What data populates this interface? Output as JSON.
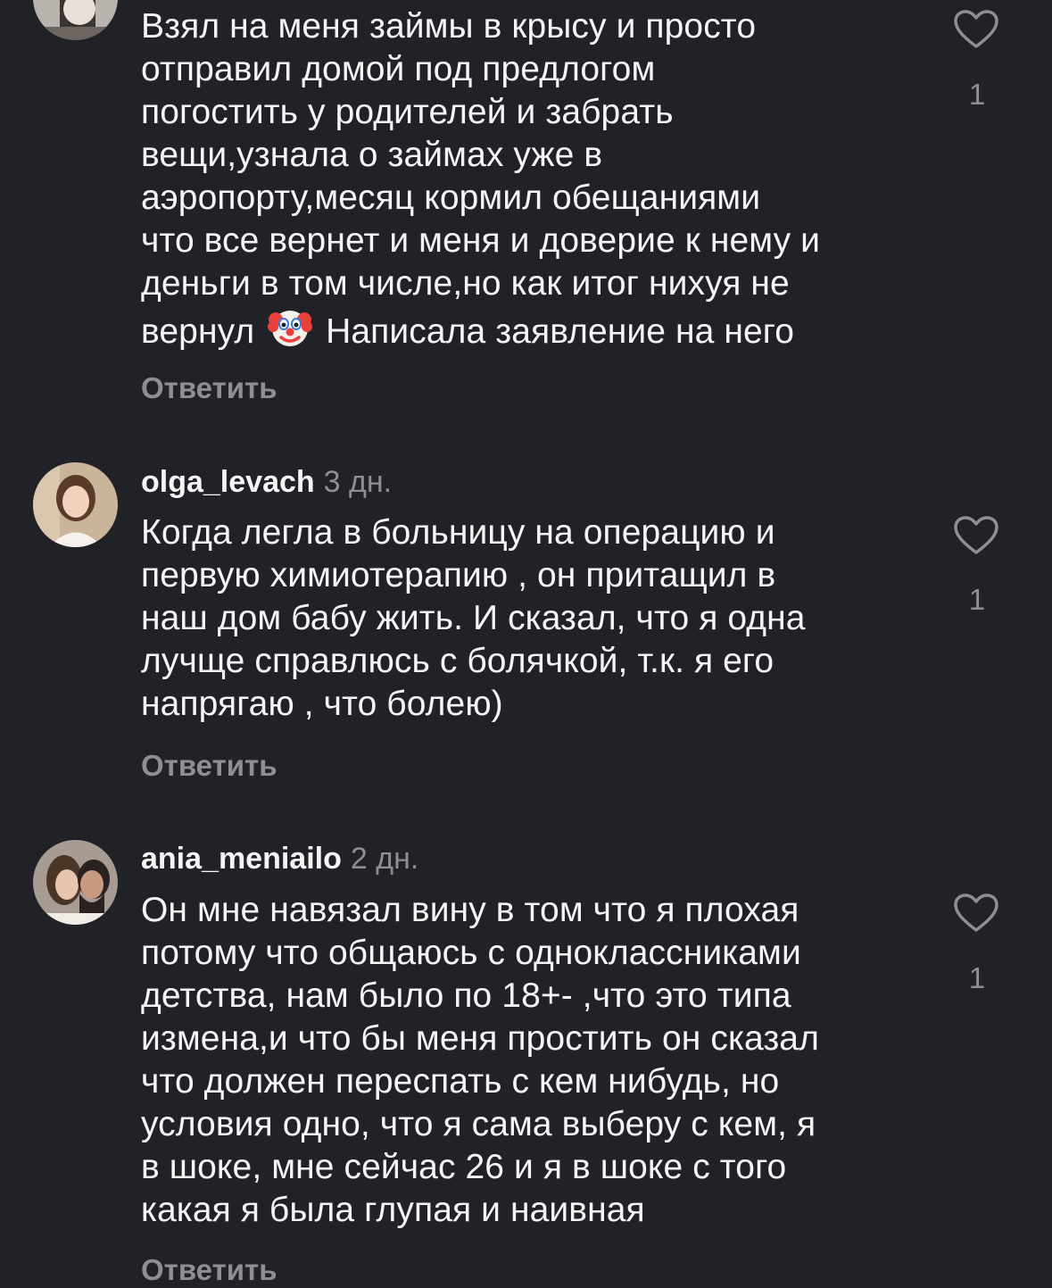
{
  "comments": [
    {
      "username": "",
      "time": "",
      "text_lines": [
        "Взял на меня займы в крысу и просто",
        "отправил домой под предлогом",
        "погостить у родителей и забрать",
        "вещи,узнала о займах уже в",
        "аэропорту,месяц кормил обещаниями",
        "что все вернет и меня и доверие к нему и",
        "деньги в том числе,но как итог нихуя не"
      ],
      "last_line_before_emoji": "вернул",
      "emoji": "clown-face",
      "last_line_after_emoji": "Написала заявление на него",
      "reply_label": "Ответить",
      "like_count": "1"
    },
    {
      "username": "olga_levach",
      "time": "3 дн.",
      "text_lines": [
        "Когда легла в больницу на операцию и",
        "первую химиотерапию , он притащил в",
        "наш дом бабу жить. И сказал, что я одна",
        "лучще справлюсь с болячкой,  т.к. я его",
        "напрягаю , что болею)"
      ],
      "reply_label": "Ответить",
      "like_count": "1"
    },
    {
      "username": "ania_meniailo",
      "time": "2 дн.",
      "text_lines": [
        "Он мне навязал вину в том что я плохая",
        "потому что общаюсь с одноклассниками",
        "детства, нам было по 18+- ,что это типа",
        "измена,и что бы меня простить он сказал",
        "что должен переспать с кем нибудь, но",
        "условия одно, что я сама выберу с кем, я",
        "в шоке, мне сейчас 26 и я в шоке с того",
        "какая я была глупая и наивная"
      ],
      "reply_label": "Ответить",
      "like_count": "1"
    }
  ],
  "colors": {
    "background": "#212228",
    "text": "#f5f5f5",
    "secondary": "#8e8e93"
  }
}
